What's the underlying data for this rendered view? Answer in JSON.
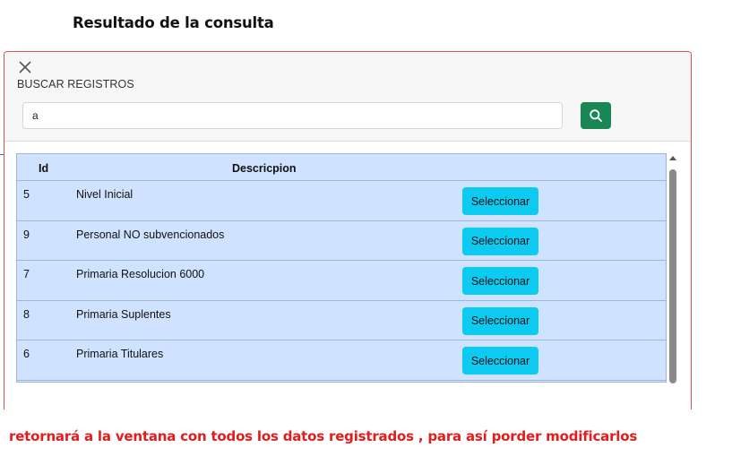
{
  "page": {
    "title": "Resultado de la consulta",
    "note": "retornará a la ventana con todos los datos registrados , para así porder modificarlos"
  },
  "modal": {
    "label": "BUSCAR REGISTROS",
    "close_icon": "close-icon",
    "search": {
      "value": "a",
      "placeholder": "",
      "button_icon": "search-icon"
    }
  },
  "table": {
    "headers": {
      "id": "Id",
      "descripcion": "Descricpion"
    },
    "rows": [
      {
        "id": "5",
        "descripcion": "Nivel Inicial",
        "action": "Seleccionar"
      },
      {
        "id": "9",
        "descripcion": "Personal NO subvencionados",
        "action": "Seleccionar"
      },
      {
        "id": "7",
        "descripcion": "Primaria Resolucion 6000",
        "action": "Seleccionar"
      },
      {
        "id": "8",
        "descripcion": "Primaria Suplentes",
        "action": "Seleccionar"
      },
      {
        "id": "6",
        "descripcion": "Primaria Titulares",
        "action": "Seleccionar"
      }
    ]
  },
  "colors": {
    "modal_border": "#d9534f",
    "search_button": "#198754",
    "select_button": "#0dcaf0",
    "table_bg": "#cfe2ff",
    "note_text": "#e11d1d"
  }
}
